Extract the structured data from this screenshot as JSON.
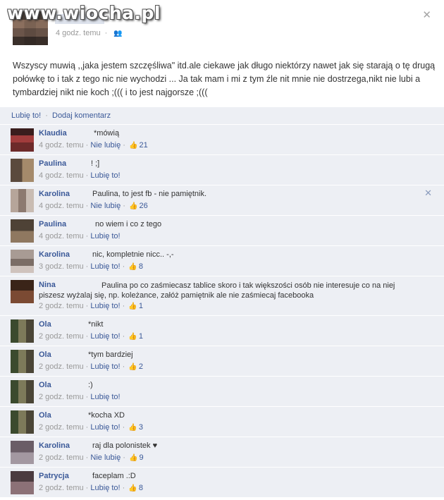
{
  "watermark": "www.wiocha.pl",
  "post": {
    "time": "4 godz. temu",
    "text": "Wszyscy muwią ,,jaka jestem szczęśliwa\" itd.ale ciekawe jak długo niektórzy nawet jak się starają o tę drugą połówkę to i tak z tego nic nie wychodzi ... Ja tak mam i mi z tym źle nit mnie nie dostrzega,nikt nie lubi a tymbardziej nikt nie koch ;((( i to jest najgorsze ;(((",
    "like_label": "Lubię to!",
    "comment_label": "Dodaj komentarz",
    "separator": "·"
  },
  "comments": [
    {
      "name": "Klaudia",
      "text": "*mówią",
      "time": "4 godz. temu",
      "action": "Nie lubię",
      "likes": "21"
    },
    {
      "name": "Paulina",
      "text": "! ;]",
      "time": "4 godz. temu",
      "action": "Lubię to!",
      "likes": ""
    },
    {
      "name": "Karolina",
      "text": "Paulina, to jest fb - nie pamiętnik.",
      "time": "4 godz. temu",
      "action": "Nie lubię",
      "likes": "26"
    },
    {
      "name": "Paulina",
      "text": "no wiem i co z tego",
      "time": "4 godz. temu",
      "action": "Lubię to!",
      "likes": ""
    },
    {
      "name": "Karolina",
      "text": "nic, kompletnie nicc.. -,-",
      "time": "3 godz. temu",
      "action": "Lubię to!",
      "likes": "8"
    },
    {
      "name": "Nina",
      "text": "Paulina po co zaśmiecasz tablice skoro i tak większości osób nie interesuje co na niej piszesz wyżalaj się, np. koleżance, załóż pamiętnik ale nie zaśmiecaj facebooka",
      "time": "2 godz. temu",
      "action": "Lubię to!",
      "likes": "1"
    },
    {
      "name": "Ola",
      "text": "*nikt",
      "time": "2 godz. temu",
      "action": "Lubię to!",
      "likes": "1"
    },
    {
      "name": "Ola",
      "text": "*tym bardziej",
      "time": "2 godz. temu",
      "action": "Lubię to!",
      "likes": "2"
    },
    {
      "name": "Ola",
      "text": ":)",
      "time": "2 godz. temu",
      "action": "Lubię to!",
      "likes": ""
    },
    {
      "name": "Ola",
      "text": "*kocha XD",
      "time": "2 godz. temu",
      "action": "Lubię to!",
      "likes": "3"
    },
    {
      "name": "Karolina",
      "text": "raj dla polonistek ♥",
      "time": "2 godz. temu",
      "action": "Nie lubię",
      "likes": "9"
    },
    {
      "name": "Patrycja",
      "text": "faceplam .:D",
      "time": "2 godz. temu",
      "action": "Lubię to!",
      "likes": "8"
    }
  ],
  "icons": {
    "close": "close-icon",
    "thumb": "thumbs-up-icon",
    "people": "friends-icon"
  },
  "colors": {
    "link": "#3b5998",
    "comment_bg": "#edeff4",
    "meta": "#999999"
  }
}
